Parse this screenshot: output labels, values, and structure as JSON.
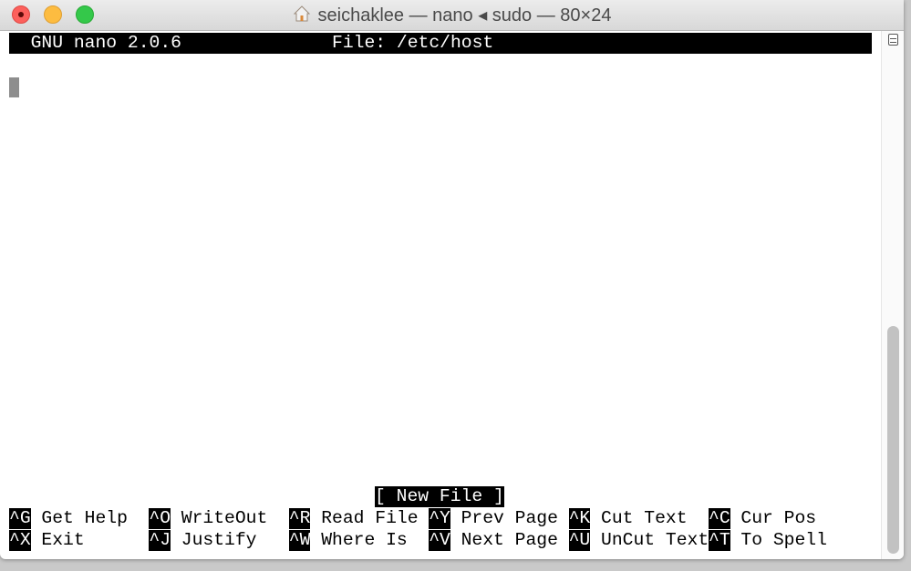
{
  "window": {
    "title": "seichaklee — nano ◂ sudo — 80×24",
    "title_icon": "home-icon"
  },
  "nano": {
    "header_left": "GNU nano 2.0.6",
    "header_file": "File: /etc/host",
    "status": "[ New File ]",
    "shortcuts_row1": [
      {
        "key": "^G",
        "label": "Get Help"
      },
      {
        "key": "^O",
        "label": "WriteOut"
      },
      {
        "key": "^R",
        "label": "Read File"
      },
      {
        "key": "^Y",
        "label": "Prev Page"
      },
      {
        "key": "^K",
        "label": "Cut Text"
      },
      {
        "key": "^C",
        "label": "Cur Pos"
      }
    ],
    "shortcuts_row2": [
      {
        "key": "^X",
        "label": "Exit"
      },
      {
        "key": "^J",
        "label": "Justify"
      },
      {
        "key": "^W",
        "label": "Where Is"
      },
      {
        "key": "^V",
        "label": "Next Page"
      },
      {
        "key": "^U",
        "label": "UnCut Text"
      },
      {
        "key": "^T",
        "label": "To Spell"
      }
    ]
  },
  "scrollbar": {
    "thumb_start_fraction": 0.54,
    "thumb_end_fraction": 1.0
  }
}
